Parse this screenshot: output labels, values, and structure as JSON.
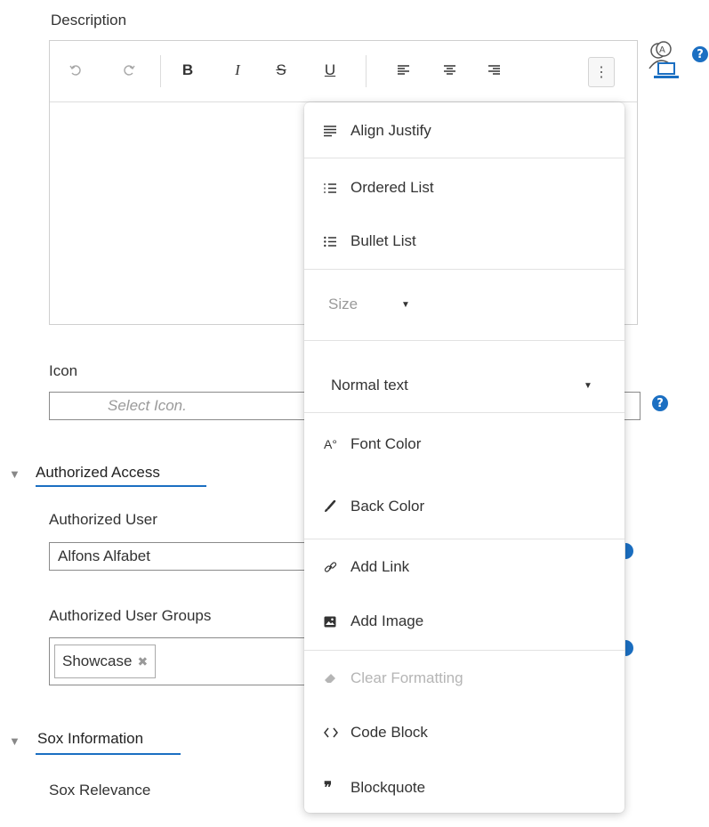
{
  "description": {
    "label": "Description",
    "toolbar": {
      "undo_icon": "undo-icon",
      "redo_icon": "redo-icon",
      "bold": "B",
      "italic": "I",
      "strike": "S",
      "underline": "U",
      "more": "⋮"
    }
  },
  "icon_field": {
    "label": "Icon",
    "placeholder": "Select Icon."
  },
  "authorized_access": {
    "title": "Authorized Access",
    "user_label": "Authorized User",
    "user_value": "Alfons Alfabet",
    "groups_label": "Authorized User Groups",
    "group_chip": "Showcase"
  },
  "sox": {
    "title": "Sox Information",
    "relevance_label": "Sox Relevance"
  },
  "menu": {
    "align_justify": "Align Justify",
    "ordered_list": "Ordered List",
    "bullet_list": "Bullet List",
    "size": "Size",
    "format": "Normal text",
    "font_color": "Font Color",
    "font_color_icon": "A°",
    "back_color": "Back Color",
    "add_link": "Add Link",
    "add_image": "Add Image",
    "clear_formatting": "Clear Formatting",
    "code_block": "Code Block",
    "blockquote": "Blockquote",
    "blockquote_icon": "❞"
  },
  "help_symbol": "?",
  "colors": {
    "accent": "#1b6fc2",
    "border": "#8a8a8a",
    "disabled": "#b5b5b5"
  }
}
